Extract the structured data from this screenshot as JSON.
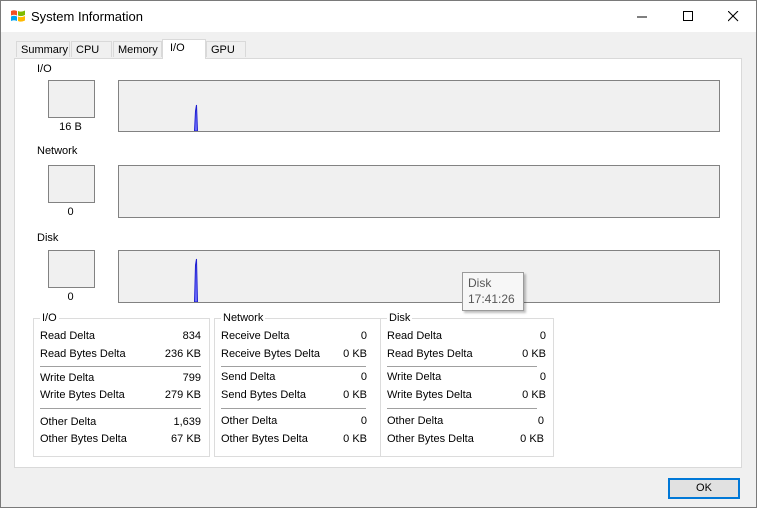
{
  "window": {
    "title": "System Information",
    "icon": "windows-flag-icon"
  },
  "tabs": [
    "Summary",
    "CPU",
    "Memory",
    "I/O",
    "GPU"
  ],
  "active_tab": "I/O",
  "sections": {
    "io": {
      "label": "I/O",
      "value": "16 B"
    },
    "network": {
      "label": "Network",
      "value": "0"
    },
    "disk": {
      "label": "Disk",
      "value": "0"
    }
  },
  "tooltip": {
    "title": "Disk",
    "time": "17:41:26"
  },
  "stats": {
    "io": {
      "title": "I/O",
      "read_delta": {
        "label": "Read Delta",
        "value": "834"
      },
      "read_bytes_delta": {
        "label": "Read Bytes Delta",
        "value": "236 KB"
      },
      "write_delta": {
        "label": "Write Delta",
        "value": "799"
      },
      "write_bytes_delta": {
        "label": "Write Bytes Delta",
        "value": "279 KB"
      },
      "other_delta": {
        "label": "Other Delta",
        "value": "1,639"
      },
      "other_bytes_delta": {
        "label": "Other Bytes Delta",
        "value": "67 KB"
      }
    },
    "network": {
      "title": "Network",
      "receive_delta": {
        "label": "Receive Delta",
        "value": "0"
      },
      "receive_bytes_delta": {
        "label": "Receive Bytes Delta",
        "value": "0 KB"
      },
      "send_delta": {
        "label": "Send Delta",
        "value": "0"
      },
      "send_bytes_delta": {
        "label": "Send Bytes Delta",
        "value": "0 KB"
      },
      "other_delta": {
        "label": "Other Delta",
        "value": "0"
      },
      "other_bytes_delta": {
        "label": "Other Bytes Delta",
        "value": "0 KB"
      }
    },
    "disk": {
      "title": "Disk",
      "read_delta": {
        "label": "Read Delta",
        "value": "0"
      },
      "read_bytes_delta": {
        "label": "Read Bytes Delta",
        "value": "0 KB"
      },
      "write_delta": {
        "label": "Write Delta",
        "value": "0"
      },
      "write_bytes_delta": {
        "label": "Write Bytes Delta",
        "value": "0 KB"
      },
      "other_delta": {
        "label": "Other Delta",
        "value": "0"
      },
      "other_bytes_delta": {
        "label": "Other Bytes Delta",
        "value": "0 KB"
      }
    }
  },
  "buttons": {
    "ok": "OK"
  },
  "colors": {
    "graph_line": "#1f1fd0",
    "graph_fill": "#7070ff",
    "focus_border": "#0078d7"
  }
}
